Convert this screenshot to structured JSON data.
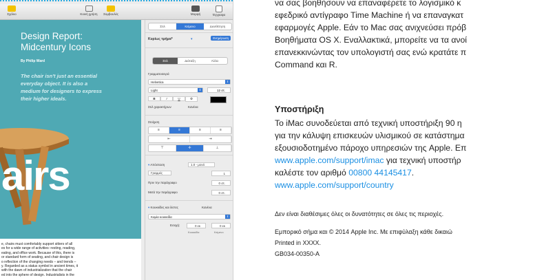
{
  "toolbar": {
    "items": [
      {
        "label": "Σχόλιο",
        "icon": "comment-icon"
      },
      {
        "label": "Κοινή χρήση",
        "icon": "share-icon"
      },
      {
        "label": "Συμβουλές",
        "icon": "tips-icon"
      },
      {
        "label": "Μορφή",
        "icon": "format-icon"
      },
      {
        "label": "Έγγραφο",
        "icon": "document-icon"
      }
    ]
  },
  "document": {
    "title_line1": "Design Report:",
    "title_line2": "Midcentury Icons",
    "author": "By Philip Ward",
    "quote": "The chair isn't just an essential everyday object. It is also a medium for designers to express their higher ideals.",
    "big_text": "airs",
    "body_lines": [
      "e, chairs must comfortably support sitters of all",
      "es for a wide range of activities: resting, reading,",
      "eating, and office work. Because of this, there is",
      "or standard form of seating, and chair design is",
      "o reflection of the changing needs – and trends –",
      "y. Regarded as a status symbol in ancient times, it",
      "with the dawn of industrialization that the chair",
      "ed into the sphere of design. Industrialists in the"
    ]
  },
  "inspector": {
    "tabs": [
      "Στιλ",
      "Κείμενο",
      "Διευθέτηση"
    ],
    "active_tab": 1,
    "style_popup": "Κυρίως τμήμα*",
    "update_button": "Ενημέρωση",
    "subtabs": [
      "Στιλ",
      "Διάταξη",
      "Άλλα"
    ],
    "font_section": "Γραμματοσειρά",
    "font_name": "Helvetica",
    "font_weight": "Light",
    "font_size": "12 στ.",
    "char_styles_label": "Στιλ χαρακτήρων",
    "char_styles_value": "Κανένα",
    "format_buttons": [
      "B",
      "I",
      "U"
    ],
    "alignment_section": "Στοίχιση",
    "spacing_label": "Απόσταση",
    "spacing_value": "1.0 - μονό",
    "lines_label": "Γραμμές",
    "lines_value": "1",
    "before_label": "Πριν την παράγραφο",
    "before_value": "0 στ.",
    "after_label": "Μετά την παράγραφο",
    "after_value": "0 στ.",
    "bullets_label": "Κουκκίδες και λίστες",
    "bullets_value": "Κανένα",
    "bullet_popup": "Καμία κουκκίδα",
    "indent_label": "Εσοχή:",
    "indent_bullet_value": "0 εκ",
    "indent_text_value": "0 εκ",
    "indent_bullet_caption": "Κουκκίδα",
    "indent_text_caption": "Κείμενο"
  },
  "manual": {
    "lines": [
      "να σας βοηθήσουν να επαναφέρετε το λογισμικό κ",
      "εφεδρικό αντίγραφο Time Machine ή να επαναγκατ",
      "εφαρμογές Apple. Εάν το Mac σας ανιχνεύσει πρόβ",
      "Βοηθήματα OS X. Εναλλακτικά, μπορείτε να τα ανοί",
      "επανεκκινώντας τον υπολογιστή σας ενώ κρατάτε π",
      "Command και R."
    ],
    "heading": "Υποστήριξη",
    "support_lines": [
      "Το iMac συνοδεύεται από τεχνική υποστήριξη 90 η",
      "για την κάλυψη επισκευών υλισμικού σε κατάστημα",
      "εξουσιοδοτημένο πάροχο υπηρεσιών της Apple. Επ"
    ],
    "link1": "www.apple.com/support/imac",
    "link1_after": " για τεχνική υποστήρ",
    "call_before": "καλέστε τον αριθμό ",
    "phone": "00800 44145417",
    "call_after": ".",
    "link2": "www.apple.com/support/country",
    "note": "Δεν είναι διαθέσιμες όλες οι δυνατότητες σε όλες τις περιοχές.",
    "copyright": "Εμπορικό σήμα και © 2014 Apple Inc. Με επιφύλαξη κάθε δικαιώ",
    "printed": "Printed in XXXX.",
    "code": "GB034-00350-A"
  },
  "colors": {
    "accent": "#3478d6",
    "doc_teal": "#4fa9b4",
    "link": "#1a8fe3"
  }
}
